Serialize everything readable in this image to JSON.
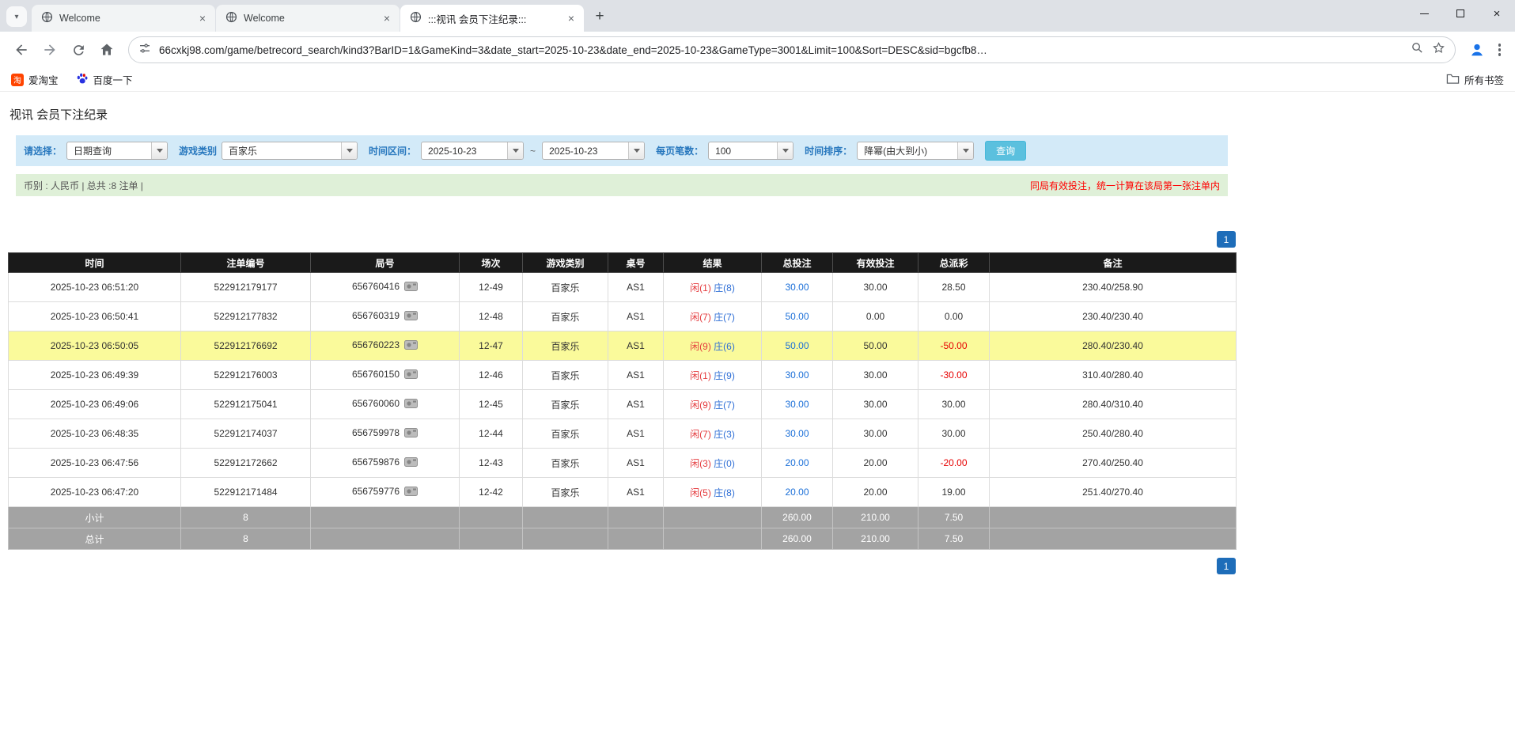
{
  "browser": {
    "tabs": [
      {
        "title": "Welcome"
      },
      {
        "title": "Welcome"
      },
      {
        "title": ":::视讯 会员下注纪录:::"
      }
    ],
    "active_tab_index": 2,
    "url": "66cxkj98.com/game/betrecord_search/kind3?BarID=1&GameKind=3&date_start=2025-10-23&date_end=2025-10-23&GameType=3001&Limit=100&Sort=DESC&sid=bgcfb8…",
    "bookmarks": [
      {
        "label": "爱淘宝"
      },
      {
        "label": "百度一下"
      }
    ],
    "all_bookmarks_label": "所有书签"
  },
  "page": {
    "title": "视讯 会员下注纪录",
    "filters": {
      "select_label": "请选择：",
      "select_value": "日期查询",
      "game_type_label": "游戏类别",
      "game_type_value": "百家乐",
      "date_range_label": "时间区间：",
      "date_start": "2025-10-23",
      "range_separator": "~",
      "date_end": "2025-10-23",
      "page_size_label": "每页笔数：",
      "page_size_value": "100",
      "sort_label": "时间排序：",
      "sort_value": "降幂(由大到小)",
      "search_button_label": "查询"
    },
    "info_bar": {
      "left": "币别 : 人民币 | 总共 :8 注单 |",
      "right": "同局有效投注，统一计算在该局第一张注单内"
    },
    "pagination_label": "1",
    "table": {
      "headers": [
        "时间",
        "注单编号",
        "局号",
        "场次",
        "游戏类别",
        "桌号",
        "结果",
        "总投注",
        "有效投注",
        "总派彩",
        "备注"
      ],
      "rows": [
        {
          "time": "2025-10-23 06:51:20",
          "bet_id": "522912179177",
          "round": "656760416",
          "session": "12-49",
          "game": "百家乐",
          "table": "AS1",
          "result_player": "闲(1)",
          "result_banker": "庄(8)",
          "total_bet": "30.00",
          "valid_bet": "30.00",
          "payout": "28.50",
          "note": "230.40/258.90",
          "highlight": false
        },
        {
          "time": "2025-10-23 06:50:41",
          "bet_id": "522912177832",
          "round": "656760319",
          "session": "12-48",
          "game": "百家乐",
          "table": "AS1",
          "result_player": "闲(7)",
          "result_banker": "庄(7)",
          "total_bet": "50.00",
          "valid_bet": "0.00",
          "payout": "0.00",
          "note": "230.40/230.40",
          "highlight": false
        },
        {
          "time": "2025-10-23 06:50:05",
          "bet_id": "522912176692",
          "round": "656760223",
          "session": "12-47",
          "game": "百家乐",
          "table": "AS1",
          "result_player": "闲(9)",
          "result_banker": "庄(6)",
          "total_bet": "50.00",
          "valid_bet": "50.00",
          "payout": "-50.00",
          "note": "280.40/230.40",
          "highlight": true
        },
        {
          "time": "2025-10-23 06:49:39",
          "bet_id": "522912176003",
          "round": "656760150",
          "session": "12-46",
          "game": "百家乐",
          "table": "AS1",
          "result_player": "闲(1)",
          "result_banker": "庄(9)",
          "total_bet": "30.00",
          "valid_bet": "30.00",
          "payout": "-30.00",
          "note": "310.40/280.40",
          "highlight": false
        },
        {
          "time": "2025-10-23 06:49:06",
          "bet_id": "522912175041",
          "round": "656760060",
          "session": "12-45",
          "game": "百家乐",
          "table": "AS1",
          "result_player": "闲(9)",
          "result_banker": "庄(7)",
          "total_bet": "30.00",
          "valid_bet": "30.00",
          "payout": "30.00",
          "note": "280.40/310.40",
          "highlight": false
        },
        {
          "time": "2025-10-23 06:48:35",
          "bet_id": "522912174037",
          "round": "656759978",
          "session": "12-44",
          "game": "百家乐",
          "table": "AS1",
          "result_player": "闲(7)",
          "result_banker": "庄(3)",
          "total_bet": "30.00",
          "valid_bet": "30.00",
          "payout": "30.00",
          "note": "250.40/280.40",
          "highlight": false
        },
        {
          "time": "2025-10-23 06:47:56",
          "bet_id": "522912172662",
          "round": "656759876",
          "session": "12-43",
          "game": "百家乐",
          "table": "AS1",
          "result_player": "闲(3)",
          "result_banker": "庄(0)",
          "total_bet": "20.00",
          "valid_bet": "20.00",
          "payout": "-20.00",
          "note": "270.40/250.40",
          "highlight": false
        },
        {
          "time": "2025-10-23 06:47:20",
          "bet_id": "522912171484",
          "round": "656759776",
          "session": "12-42",
          "game": "百家乐",
          "table": "AS1",
          "result_player": "闲(5)",
          "result_banker": "庄(8)",
          "total_bet": "20.00",
          "valid_bet": "20.00",
          "payout": "19.00",
          "note": "251.40/270.40",
          "highlight": false
        }
      ],
      "summary_rows": [
        {
          "label": "小计",
          "count": "8",
          "total_bet": "260.00",
          "valid_bet": "210.00",
          "payout": "7.50"
        },
        {
          "label": "总计",
          "count": "8",
          "total_bet": "260.00",
          "valid_bet": "210.00",
          "payout": "7.50"
        }
      ]
    },
    "colors": {
      "filter_bar_bg": "#d3eaf8",
      "info_bar_bg": "#dff0d8",
      "header_bg": "#1a1a1a",
      "highlight_yellow": "#fafa9b",
      "summary_gray": "#a3a3a3",
      "pagination_blue": "#1e6db9",
      "search_button_blue": "#5bc0de",
      "label_blue": "#2878be",
      "link_blue": "#1b6fd8",
      "negative_red": "#e60000",
      "player_red": "#e4393c",
      "banker_blue": "#2f6fd6",
      "notice_red": "#ff0000"
    }
  }
}
